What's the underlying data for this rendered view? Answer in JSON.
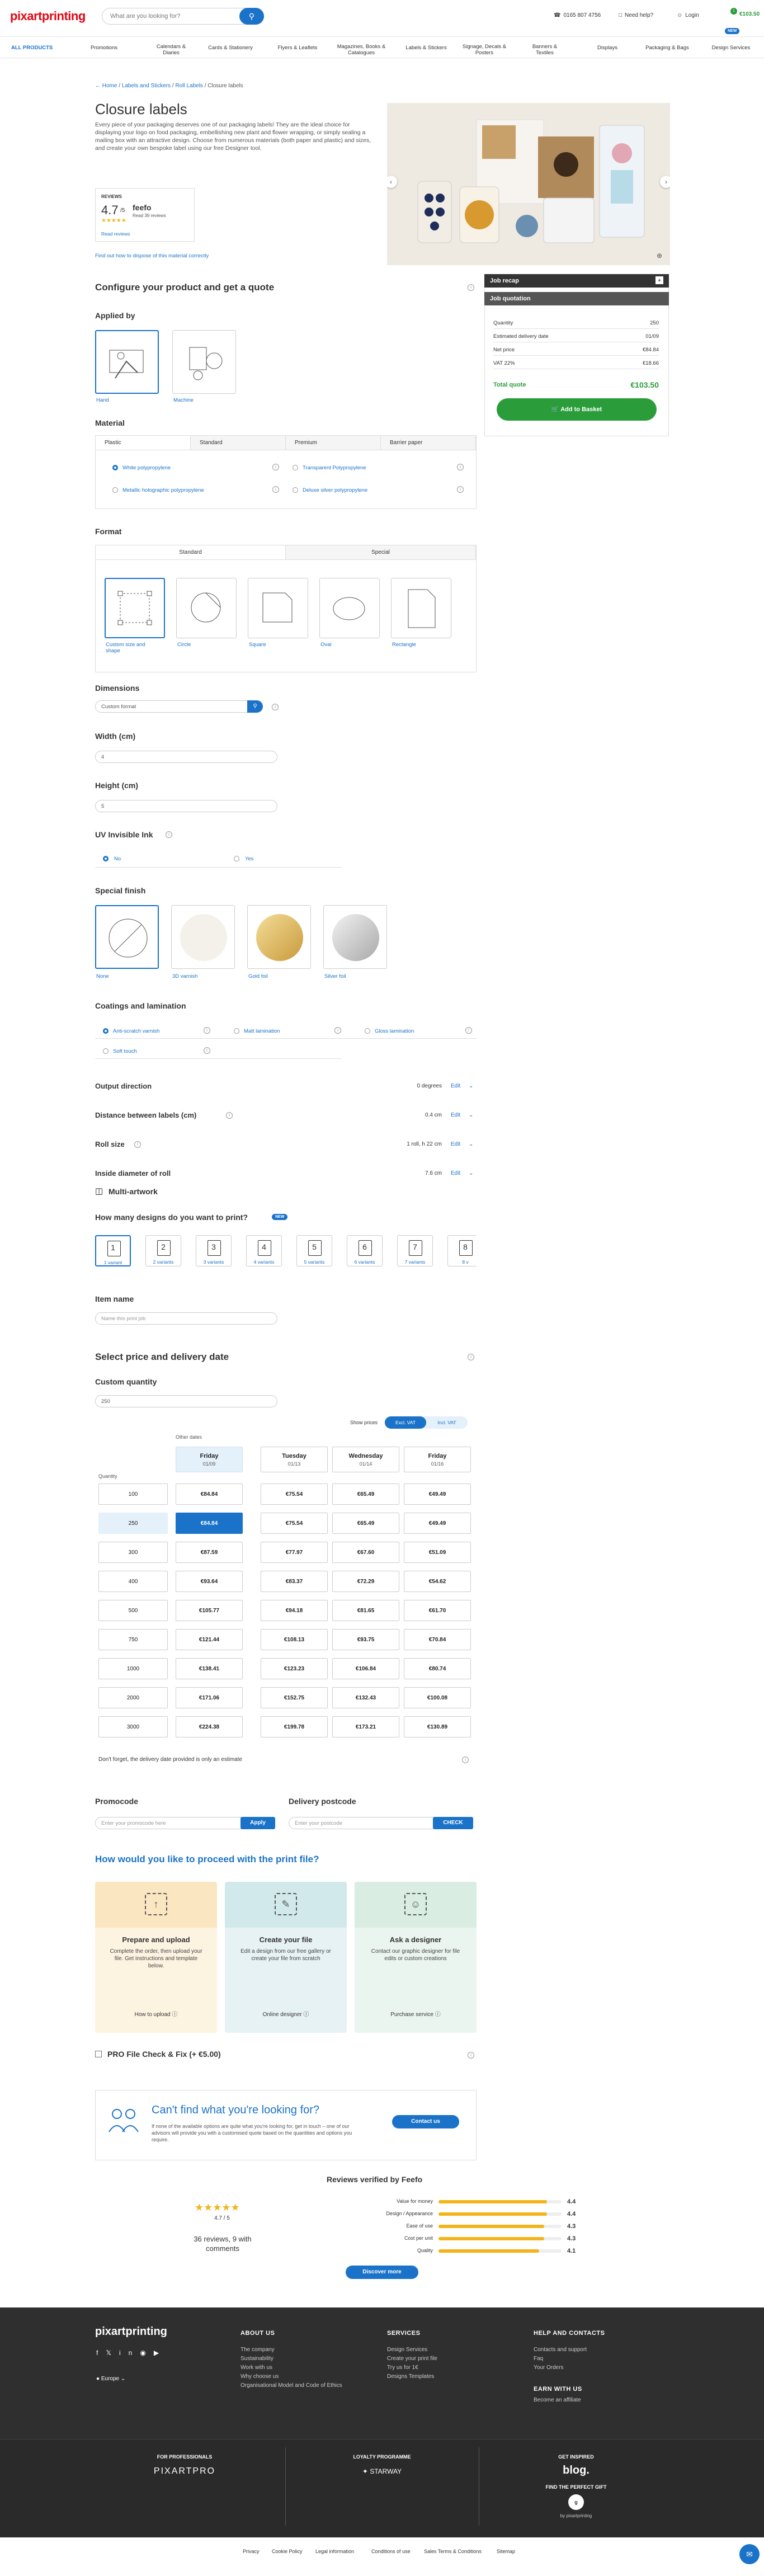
{
  "header": {
    "logo": "pixartprinting",
    "search_placeholder": "What are you looking for?",
    "phone": "0165 807 4756",
    "help": "Need help?",
    "login": "Login",
    "cart_count": "1",
    "cart_total": "€103.50"
  },
  "nav": {
    "all_products": "ALL PRODUCTS",
    "items": [
      "Promotions",
      "Calendars & Diaries",
      "Cards & Stationery",
      "Flyers & Leaflets",
      "Magazines, Books & Catalogues",
      "Labels & Stickers",
      "Signage, Decals & Posters",
      "Banners & Textiles",
      "Displays",
      "Packaging & Bags",
      "Design Services"
    ],
    "new_badge": "NEW"
  },
  "breadcrumb": [
    "Home",
    "Labels and Stickers",
    "Roll Labels",
    "Closure labels"
  ],
  "product": {
    "title": "Closure labels",
    "description": "Every piece of your packaging deserves one of our packaging labels! They are the ideal choice for displaying your logo on food packaging, embellishing new plant and flower wrapping, or simply sealing a mailing box with an attractive design. Choose from numerous materials (both paper and plastic) and sizes, and create your own bespoke label using our free Designer tool.",
    "reviews_label": "REVIEWS",
    "rating": "4.7",
    "rating_out_of": "/5",
    "feefo_label": "feefo",
    "feefo_sub": "Read 39 reviews",
    "read_reviews": "Read reviews",
    "link_bottom": "Find out how to dispose of this material correctly"
  },
  "configure": {
    "heading": "Configure your product and get a quote",
    "applied_by": {
      "title": "Applied by",
      "options": [
        "Hand",
        "Machine"
      ]
    },
    "material": {
      "title": "Material",
      "tabs": [
        "Plastic",
        "Standard",
        "Premium",
        "Barrier paper"
      ],
      "options": [
        "White polypropylene",
        "Transparent Polypropylene",
        "Metallic holographic polypropylene",
        "Deluxe silver polypropylene"
      ]
    },
    "format": {
      "title": "Format",
      "tabs": [
        "Standard",
        "Special"
      ],
      "options": [
        "Custom size and shape",
        "Circle",
        "Square",
        "Oval",
        "Rectangle"
      ]
    },
    "dimensions": {
      "title": "Dimensions",
      "value": "Custom format"
    },
    "width": {
      "title": "Width (cm)",
      "value": "4"
    },
    "height": {
      "title": "Height (cm)",
      "value": "5"
    },
    "uv": {
      "title": "UV Invisible Ink",
      "options": [
        "No",
        "Yes"
      ]
    },
    "special_finish": {
      "title": "Special finish",
      "options": [
        "None",
        "3D varnish",
        "Gold foil",
        "Silver foil"
      ]
    },
    "coatings": {
      "title": "Coatings and lamination",
      "options": [
        "Anti-scratch varnish",
        "Matt lamination",
        "Gloss lamination",
        "Soft touch"
      ]
    },
    "output_direction": {
      "title": "Output direction",
      "value": "0 degrees",
      "edit": "Edit"
    },
    "distance": {
      "title": "Distance between labels (cm)",
      "value": "0.4 cm",
      "edit": "Edit"
    },
    "roll_size": {
      "title": "Roll size",
      "value": "1 roll, h 22 cm",
      "edit": "Edit"
    },
    "inside_diameter": {
      "title": "Inside diameter of roll",
      "value": "7.6 cm",
      "edit": "Edit"
    },
    "multi_artwork": "Multi-artwork",
    "designs": {
      "title": "How many designs do you want to print?",
      "badge": "NEW",
      "items": [
        {
          "n": "1",
          "label": "1 variant"
        },
        {
          "n": "2",
          "label": "2 variants"
        },
        {
          "n": "3",
          "label": "3 variants"
        },
        {
          "n": "4",
          "label": "4 variants"
        },
        {
          "n": "5",
          "label": "5 variants"
        },
        {
          "n": "6",
          "label": "6 variants"
        },
        {
          "n": "7",
          "label": "7 variants"
        },
        {
          "n": "8",
          "label": "8 v"
        }
      ]
    },
    "item_name": {
      "title": "Item name",
      "placeholder": "Name this print job"
    }
  },
  "price": {
    "heading": "Select price and delivery date",
    "custom_qty_title": "Custom quantity",
    "custom_qty_value": "250",
    "show_prices": "Show prices",
    "vat_options": [
      "Excl. VAT",
      "Incl. VAT"
    ],
    "other_dates": "Other dates",
    "quantity_label": "Quantity",
    "days": [
      {
        "name": "Friday",
        "date": "01/09"
      },
      {
        "name": "Tuesday",
        "date": "01/13"
      },
      {
        "name": "Wednesday",
        "date": "01/14"
      },
      {
        "name": "Friday",
        "date": "01/16"
      }
    ],
    "rows": [
      {
        "qty": "100",
        "prices": [
          "€84.84",
          "€75.54",
          "€65.49",
          "€49.49"
        ]
      },
      {
        "qty": "250",
        "prices": [
          "€84.84",
          "€75.54",
          "€65.49",
          "€49.49"
        ]
      },
      {
        "qty": "300",
        "prices": [
          "€87.59",
          "€77.97",
          "€67.60",
          "€51.09"
        ]
      },
      {
        "qty": "400",
        "prices": [
          "€93.64",
          "€83.37",
          "€72.29",
          "€54.62"
        ]
      },
      {
        "qty": "500",
        "prices": [
          "€105.77",
          "€94.18",
          "€81.65",
          "€61.70"
        ]
      },
      {
        "qty": "750",
        "prices": [
          "€121.44",
          "€108.13",
          "€93.75",
          "€70.84"
        ]
      },
      {
        "qty": "1000",
        "prices": [
          "€138.41",
          "€123.23",
          "€106.84",
          "€80.74"
        ]
      },
      {
        "qty": "2000",
        "prices": [
          "€171.06",
          "€152.75",
          "€132.43",
          "€100.08"
        ]
      },
      {
        "qty": "3000",
        "prices": [
          "€224.38",
          "€199.78",
          "€173.21",
          "€130.89"
        ]
      }
    ],
    "note": "Don't forget, the delivery date provided is only an estimate"
  },
  "promo": {
    "title": "Promocode",
    "placeholder": "Enter your promocode here",
    "apply": "Apply"
  },
  "postcode": {
    "title": "Delivery postcode",
    "placeholder": "Enter your postcode",
    "check": "CHECK"
  },
  "proceed": {
    "heading": "How would you like to proceed with the print file?",
    "cards": [
      {
        "title": "Prepare and upload",
        "desc": "Complete the order, then upload your file. Get instructions and template below.",
        "link": "How to upload",
        "color": "#fbe6c2"
      },
      {
        "title": "Create your file",
        "desc": "Edit a design from our free gallery or create your file from scratch",
        "link": "Online designer",
        "color": "#d2e9ec"
      },
      {
        "title": "Ask a designer",
        "desc": "Contact our graphic designer for file edits or custom creations",
        "link": "Purchase service",
        "color": "#d9ede3"
      }
    ]
  },
  "pro_check": "PRO File Check & Fix (+ €5.00)",
  "cant_find": {
    "title": "Can't find what you're looking for?",
    "desc": "If none of the available options are quite what you're looking for, get in touch – one of our advisors will provide you with a customised quote based on the quantities and options you require.",
    "button": "Contact us"
  },
  "feefo": {
    "title": "Reviews verified by Feefo",
    "rating": "4.7 / 5",
    "reviews": "36 reviews, 9 with comments",
    "metrics": [
      {
        "label": "Value for money",
        "value": "4.4",
        "fill": 0.88
      },
      {
        "label": "Design / Appearance",
        "value": "4.4",
        "fill": 0.88
      },
      {
        "label": "Ease of use",
        "value": "4.3",
        "fill": 0.86
      },
      {
        "label": "Cost per unit",
        "value": "4.3",
        "fill": 0.86
      },
      {
        "label": "Quality",
        "value": "4.1",
        "fill": 0.82
      }
    ],
    "discover": "Discover more"
  },
  "recap": {
    "title": "Job recap",
    "quotation": "Job quotation",
    "rows": [
      {
        "label": "Quantity",
        "value": "250"
      },
      {
        "label": "Estimated delivery date",
        "value": "01/09"
      },
      {
        "label": "Net price",
        "value": "€84.84"
      },
      {
        "label": "VAT 22%",
        "value": "€18.66"
      }
    ],
    "total_label": "Total quote",
    "total_value": "€103.50",
    "add_button": "Add to Basket"
  },
  "footer": {
    "logo": "pixartprinting",
    "region": "Europe",
    "cols": [
      {
        "title": "ABOUT US",
        "links": [
          "The company",
          "Sustainability",
          "Work with us",
          "Why choose us",
          "Organisational Model and Code of Ethics"
        ]
      },
      {
        "title": "SERVICES",
        "links": [
          "Design Services",
          "Create your print file",
          "Try us for 1€",
          "Designs Templates"
        ]
      },
      {
        "title": "HELP AND CONTACTS",
        "links": [
          "Contacts and support",
          "Faq",
          "Your Orders"
        ]
      }
    ],
    "earn_title": "EARN WITH US",
    "earn_link": "Become an affiliate",
    "for_pros": "FOR PROFESSIONALS",
    "pro_logo": "PIXARTPRO",
    "loyalty": "LOYALTY PROGRAMME",
    "loyalty_logo": "STARWAY",
    "inspired": "GET INSPIRED",
    "blog": "blog.",
    "gift_title": "FIND THE PERFECT GIFT",
    "gift_sub": "by pixartprinting",
    "bottom_links": [
      "Privacy",
      "Cookie Policy",
      "Legal information",
      "Conditions of use",
      "Sales Terms & Conditions",
      "Sitemap"
    ]
  }
}
